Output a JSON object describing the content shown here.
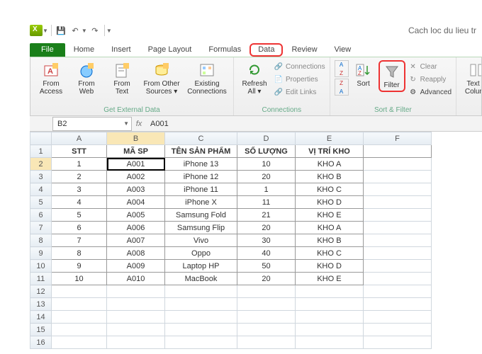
{
  "doc_title": "Cach loc du lieu tr",
  "qat": {
    "save": "💾",
    "undo": "↶",
    "redo": "↷"
  },
  "tabs": {
    "file": "File",
    "home": "Home",
    "insert": "Insert",
    "page_layout": "Page Layout",
    "formulas": "Formulas",
    "data": "Data",
    "review": "Review",
    "view": "View"
  },
  "ribbon": {
    "get_external": {
      "label": "Get External Data",
      "from_access": "From\nAccess",
      "from_web": "From\nWeb",
      "from_text": "From\nText",
      "from_other": "From Other\nSources ▾",
      "existing": "Existing\nConnections"
    },
    "connections": {
      "label": "Connections",
      "refresh": "Refresh\nAll ▾",
      "connections": "Connections",
      "properties": "Properties",
      "edit_links": "Edit Links"
    },
    "sort_filter": {
      "label": "Sort & Filter",
      "sort_az": "A→Z",
      "sort_za": "Z→A",
      "sort": "Sort",
      "filter": "Filter",
      "clear": "Clear",
      "reapply": "Reapply",
      "advanced": "Advanced"
    },
    "tools": {
      "text_to_columns": "Text to\nColumn"
    }
  },
  "namebox": "B2",
  "formula": "A001",
  "fx_label": "fx",
  "columns": [
    "A",
    "B",
    "C",
    "D",
    "E",
    "F"
  ],
  "headers": {
    "stt": "STT",
    "masp": "MÃ SP",
    "tensp": "TÊN SẢN PHẨM",
    "sl": "SỐ LƯỢNG",
    "kho": "VỊ TRÍ KHO"
  },
  "rows": [
    {
      "stt": "1",
      "masp": "A001",
      "tensp": "iPhone 13",
      "sl": "10",
      "kho": "KHO A"
    },
    {
      "stt": "2",
      "masp": "A002",
      "tensp": "iPhone 12",
      "sl": "20",
      "kho": "KHO B"
    },
    {
      "stt": "3",
      "masp": "A003",
      "tensp": "iPhone 11",
      "sl": "1",
      "kho": "KHO C"
    },
    {
      "stt": "4",
      "masp": "A004",
      "tensp": "iPhone X",
      "sl": "11",
      "kho": "KHO D"
    },
    {
      "stt": "5",
      "masp": "A005",
      "tensp": "Samsung Fold",
      "sl": "21",
      "kho": "KHO E"
    },
    {
      "stt": "6",
      "masp": "A006",
      "tensp": "Samsung Flip",
      "sl": "20",
      "kho": "KHO A"
    },
    {
      "stt": "7",
      "masp": "A007",
      "tensp": "Vivo",
      "sl": "30",
      "kho": "KHO B"
    },
    {
      "stt": "8",
      "masp": "A008",
      "tensp": "Oppo",
      "sl": "40",
      "kho": "KHO C"
    },
    {
      "stt": "9",
      "masp": "A009",
      "tensp": "Laptop HP",
      "sl": "50",
      "kho": "KHO D"
    },
    {
      "stt": "10",
      "masp": "A010",
      "tensp": "MacBook",
      "sl": "20",
      "kho": "KHO E"
    }
  ]
}
